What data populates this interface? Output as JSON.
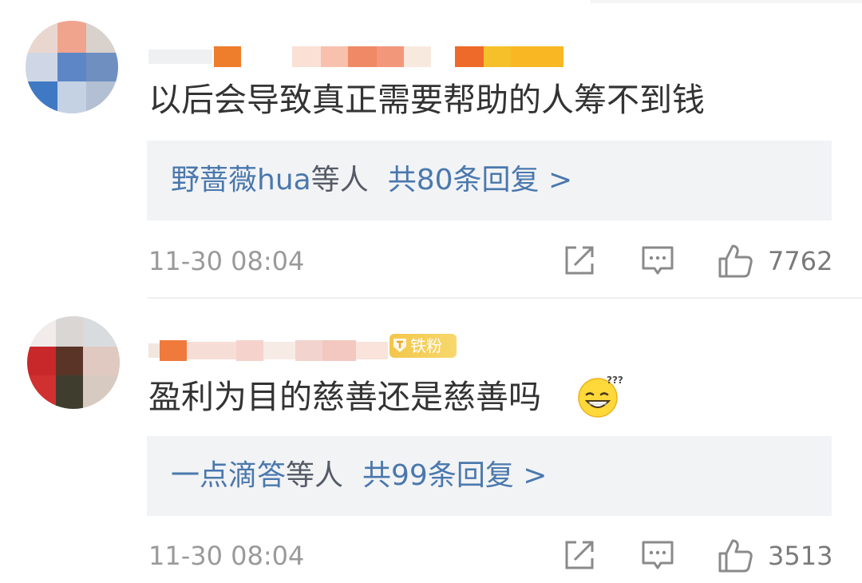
{
  "comments": [
    {
      "text": "以后会导致真正需要帮助的人筹不到钱",
      "replies": {
        "names": "野蔷薇hua",
        "suffix": "等人",
        "count": "共80条回复 >"
      },
      "time": "11-30 08:04",
      "likes": "7762",
      "icons": [
        "avatar",
        "share-icon",
        "comment-icon",
        "thumbs-up-icon"
      ]
    },
    {
      "text": "盈利为目的慈善还是慈善吗",
      "badge": "铁粉",
      "replies": {
        "names": "一点滴答",
        "suffix": "等人",
        "count": "共99条回复 >"
      },
      "time": "11-30 08:04",
      "likes": "3513",
      "icons": [
        "avatar",
        "fan-badge-icon",
        "confused-grin-emoji-icon",
        "share-icon",
        "comment-icon",
        "thumbs-up-icon"
      ]
    }
  ],
  "colors": {
    "reply_link": "#4a78ad",
    "reply_bg": "#f2f3f5",
    "body_text": "#333333",
    "meta_text": "#9a9a9a",
    "badge": "#f3c64a"
  }
}
